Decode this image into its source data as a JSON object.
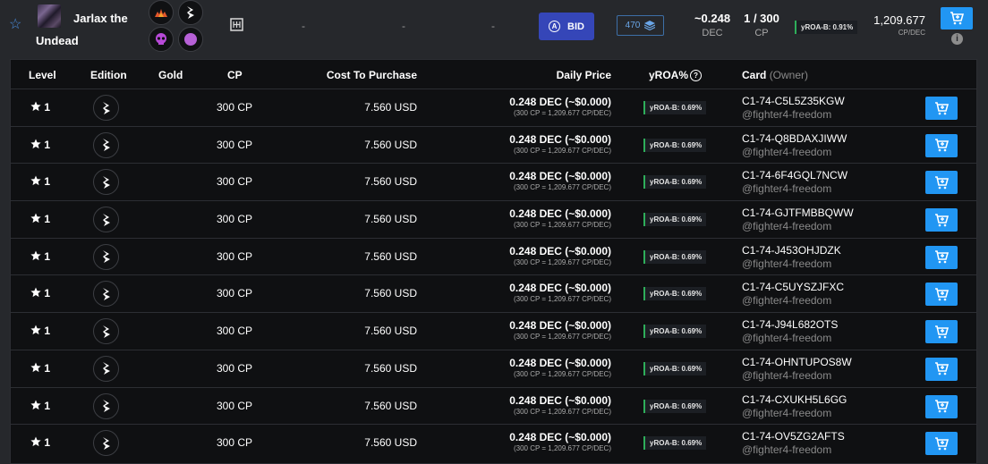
{
  "header": {
    "card_name_line1": "Jarlax the",
    "card_name_line2": "Undead",
    "dash1": "-",
    "dash2": "-",
    "dash3": "-",
    "bid_label": "BID",
    "bid_icon": "A",
    "stack_count": "470",
    "dec_value": "~0.248",
    "dec_label": "DEC",
    "cp_value": "1 / 300",
    "cp_label": "CP",
    "yroa_badge": "yROA-B: 0.91%",
    "cp_per_dec_value": "1,209.677",
    "cp_per_dec_label": "CP/DEC",
    "info": "i",
    "icons": [
      "favorite-star-icon",
      "card-art",
      "fire-element-icon",
      "edition-icon",
      "skull-icon",
      "magic-orb-icon",
      "map-icon",
      "stack-icon",
      "cart-icon",
      "info-icon"
    ]
  },
  "table": {
    "headers": {
      "level": "Level",
      "edition": "Edition",
      "gold": "Gold",
      "cp": "CP",
      "cost": "Cost To Purchase",
      "daily": "Daily Price",
      "yroa": "yROA%",
      "card": "Card",
      "owner": "(Owner)"
    },
    "rows": [
      {
        "level": "1",
        "cp": "300 CP",
        "cost": "7.560 USD",
        "daily": "0.248 DEC (~$0.000)",
        "daily_sub": "(300 CP = 1,209.677 CP/DEC)",
        "yroa": "yROA-B: 0.69%",
        "card_id": "C1-74-C5L5Z35KGW",
        "owner": "@fighter4-freedom"
      },
      {
        "level": "1",
        "cp": "300 CP",
        "cost": "7.560 USD",
        "daily": "0.248 DEC (~$0.000)",
        "daily_sub": "(300 CP = 1,209.677 CP/DEC)",
        "yroa": "yROA-B: 0.69%",
        "card_id": "C1-74-Q8BDAXJIWW",
        "owner": "@fighter4-freedom"
      },
      {
        "level": "1",
        "cp": "300 CP",
        "cost": "7.560 USD",
        "daily": "0.248 DEC (~$0.000)",
        "daily_sub": "(300 CP = 1,209.677 CP/DEC)",
        "yroa": "yROA-B: 0.69%",
        "card_id": "C1-74-6F4GQL7NCW",
        "owner": "@fighter4-freedom"
      },
      {
        "level": "1",
        "cp": "300 CP",
        "cost": "7.560 USD",
        "daily": "0.248 DEC (~$0.000)",
        "daily_sub": "(300 CP = 1,209.677 CP/DEC)",
        "yroa": "yROA-B: 0.69%",
        "card_id": "C1-74-GJTFMBBQWW",
        "owner": "@fighter4-freedom"
      },
      {
        "level": "1",
        "cp": "300 CP",
        "cost": "7.560 USD",
        "daily": "0.248 DEC (~$0.000)",
        "daily_sub": "(300 CP = 1,209.677 CP/DEC)",
        "yroa": "yROA-B: 0.69%",
        "card_id": "C1-74-J453OHJDZK",
        "owner": "@fighter4-freedom"
      },
      {
        "level": "1",
        "cp": "300 CP",
        "cost": "7.560 USD",
        "daily": "0.248 DEC (~$0.000)",
        "daily_sub": "(300 CP = 1,209.677 CP/DEC)",
        "yroa": "yROA-B: 0.69%",
        "card_id": "C1-74-C5UYSZJFXC",
        "owner": "@fighter4-freedom"
      },
      {
        "level": "1",
        "cp": "300 CP",
        "cost": "7.560 USD",
        "daily": "0.248 DEC (~$0.000)",
        "daily_sub": "(300 CP = 1,209.677 CP/DEC)",
        "yroa": "yROA-B: 0.69%",
        "card_id": "C1-74-J94L682OTS",
        "owner": "@fighter4-freedom"
      },
      {
        "level": "1",
        "cp": "300 CP",
        "cost": "7.560 USD",
        "daily": "0.248 DEC (~$0.000)",
        "daily_sub": "(300 CP = 1,209.677 CP/DEC)",
        "yroa": "yROA-B: 0.69%",
        "card_id": "C1-74-OHNTUPOS8W",
        "owner": "@fighter4-freedom"
      },
      {
        "level": "1",
        "cp": "300 CP",
        "cost": "7.560 USD",
        "daily": "0.248 DEC (~$0.000)",
        "daily_sub": "(300 CP = 1,209.677 CP/DEC)",
        "yroa": "yROA-B: 0.69%",
        "card_id": "C1-74-CXUKH5L6GG",
        "owner": "@fighter4-freedom"
      },
      {
        "level": "1",
        "cp": "300 CP",
        "cost": "7.560 USD",
        "daily": "0.248 DEC (~$0.000)",
        "daily_sub": "(300 CP = 1,209.677 CP/DEC)",
        "yroa": "yROA-B: 0.69%",
        "card_id": "C1-74-OV5ZG2AFTS",
        "owner": "@fighter4-freedom"
      }
    ]
  },
  "colors": {
    "background": "#26282c",
    "table_bg": "#0f1012",
    "accent_blue": "#2196f3",
    "bid_blue": "#3546b8",
    "yroa_green": "#2eae5a"
  }
}
